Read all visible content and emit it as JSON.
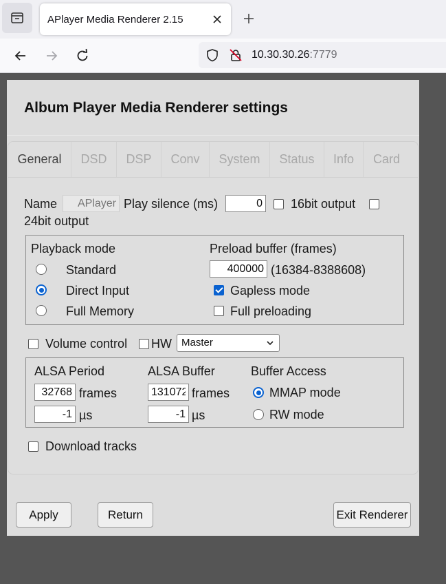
{
  "browser": {
    "tab_title": "APlayer Media Renderer 2.15",
    "url_host": "10.30.30.26",
    "url_port": ":7779"
  },
  "dialog": {
    "title": "Album Player Media Renderer settings",
    "tabs": [
      {
        "label": "General",
        "active": true
      },
      {
        "label": "DSD",
        "active": false
      },
      {
        "label": "DSP",
        "active": false
      },
      {
        "label": "Conv",
        "active": false
      },
      {
        "label": "System",
        "active": false
      },
      {
        "label": "Status",
        "active": false
      },
      {
        "label": "Info",
        "active": false
      },
      {
        "label": "Card",
        "active": false
      }
    ],
    "general": {
      "name_label": "Name",
      "name_value": "APlayer",
      "play_silence_label": "Play silence (ms)",
      "play_silence_value": "0",
      "bit16_label": "16bit output",
      "bit16_checked": false,
      "bit24_label": "24bit output",
      "bit24_checked": false,
      "playback_mode": {
        "label": "Playback mode",
        "options": [
          "Standard",
          "Direct Input",
          "Full Memory"
        ],
        "selected": "Direct Input"
      },
      "preload": {
        "label": "Preload buffer (frames)",
        "value": "400000",
        "range": "(16384-8388608)",
        "gapless_label": "Gapless mode",
        "gapless_checked": true,
        "full_preload_label": "Full preloading",
        "full_preload_checked": false
      },
      "volume_control_label": "Volume control",
      "volume_control_checked": false,
      "hw_label": "HW",
      "hw_checked": false,
      "mixer_value": "Master",
      "alsa": {
        "period_label": "ALSA Period",
        "period_frames": "32768",
        "period_us": "-1",
        "buffer_label": "ALSA Buffer",
        "buffer_frames": "131072",
        "buffer_us": "-1",
        "frames_unit": "frames",
        "us_unit": "µs",
        "access_label": "Buffer Access",
        "access_options": [
          "MMAP mode",
          "RW mode"
        ],
        "access_selected": "MMAP mode"
      },
      "download_tracks_label": "Download tracks",
      "download_tracks_checked": false
    },
    "buttons": {
      "apply": "Apply",
      "return": "Return",
      "exit": "Exit Renderer"
    }
  }
}
